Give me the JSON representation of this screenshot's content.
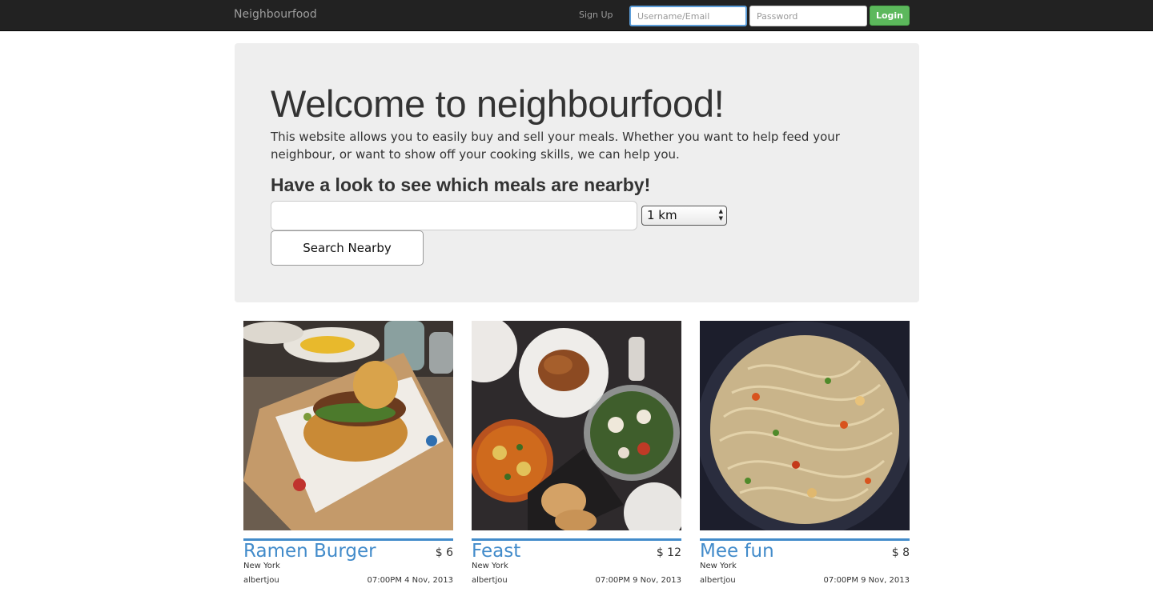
{
  "navbar": {
    "brand": "Neighbourfood",
    "signup_label": "Sign Up",
    "username_placeholder": "Username/Email",
    "password_placeholder": "Password",
    "login_label": "Login"
  },
  "hero": {
    "title": "Welcome to neighbourfood!",
    "description": "This website allows you to easily buy and sell your meals. Whether you want to help feed your neighbour, or want to show off your cooking skills, we can help you.",
    "subtitle": "Have a look to see which meals are nearby!",
    "location_value": "",
    "distance_selected": "1 km",
    "search_label": "Search Nearby"
  },
  "meals": [
    {
      "name": "Ramen Burger",
      "price": "$ 6",
      "location": "New York",
      "user": "albertjou",
      "time": "07:00PM 4 Nov, 2013",
      "image": "ramen-burger-photo"
    },
    {
      "name": "Feast",
      "price": "$ 12",
      "location": "New York",
      "user": "albertjou",
      "time": "07:00PM 9 Nov, 2013",
      "image": "feast-photo"
    },
    {
      "name": "Mee fun",
      "price": "$ 8",
      "location": "New York",
      "user": "albertjou",
      "time": "07:00PM 9 Nov, 2013",
      "image": "mee-fun-photo"
    }
  ],
  "colors": {
    "navbar_bg": "#222222",
    "link_blue": "#428bca",
    "login_green": "#5cb85c",
    "jumbotron_bg": "#eeeeee"
  }
}
